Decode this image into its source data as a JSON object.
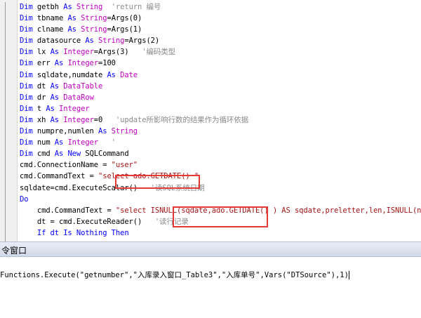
{
  "editor": {
    "lines": [
      [
        {
          "t": "Dim ",
          "c": "kw"
        },
        {
          "t": "getbh "
        },
        {
          "t": "As ",
          "c": "kw"
        },
        {
          "t": "String",
          "c": "mag"
        },
        {
          "t": "  'return 编号",
          "c": "cmt"
        }
      ],
      [
        {
          "t": "Dim ",
          "c": "kw"
        },
        {
          "t": "tbname "
        },
        {
          "t": "As ",
          "c": "kw"
        },
        {
          "t": "String",
          "c": "mag"
        },
        {
          "t": "=Args(0)"
        }
      ],
      [
        {
          "t": "Dim ",
          "c": "kw"
        },
        {
          "t": "clname "
        },
        {
          "t": "As ",
          "c": "kw"
        },
        {
          "t": "String",
          "c": "mag"
        },
        {
          "t": "=Args(1)"
        }
      ],
      [
        {
          "t": "Dim ",
          "c": "kw"
        },
        {
          "t": "datasource "
        },
        {
          "t": "As ",
          "c": "kw"
        },
        {
          "t": "String",
          "c": "mag"
        },
        {
          "t": "=Args(2)"
        }
      ],
      [
        {
          "t": "Dim ",
          "c": "kw"
        },
        {
          "t": "lx "
        },
        {
          "t": "As ",
          "c": "kw"
        },
        {
          "t": "Integer",
          "c": "mag"
        },
        {
          "t": "=Args(3)   "
        },
        {
          "t": "'编码类型",
          "c": "cmt"
        }
      ],
      [
        {
          "t": "Dim ",
          "c": "kw"
        },
        {
          "t": "err "
        },
        {
          "t": "As ",
          "c": "kw"
        },
        {
          "t": "Integer",
          "c": "mag"
        },
        {
          "t": "=100"
        }
      ],
      [
        {
          "t": "Dim ",
          "c": "kw"
        },
        {
          "t": "sqldate,numdate "
        },
        {
          "t": "As ",
          "c": "kw"
        },
        {
          "t": "Date",
          "c": "mag"
        }
      ],
      [
        {
          "t": "Dim ",
          "c": "kw"
        },
        {
          "t": "dt "
        },
        {
          "t": "As ",
          "c": "kw"
        },
        {
          "t": "DataTable",
          "c": "mag"
        }
      ],
      [
        {
          "t": "Dim ",
          "c": "kw"
        },
        {
          "t": "dr "
        },
        {
          "t": "As ",
          "c": "kw"
        },
        {
          "t": "DataRow",
          "c": "mag"
        }
      ],
      [
        {
          "t": "Dim ",
          "c": "kw"
        },
        {
          "t": "t "
        },
        {
          "t": "As ",
          "c": "kw"
        },
        {
          "t": "Integer",
          "c": "mag"
        }
      ],
      [
        {
          "t": "Dim ",
          "c": "kw"
        },
        {
          "t": "xh "
        },
        {
          "t": "As ",
          "c": "kw"
        },
        {
          "t": "Integer",
          "c": "mag"
        },
        {
          "t": "=0   "
        },
        {
          "t": "'update所影响行数的结果作为循环依据",
          "c": "cmt"
        }
      ],
      [
        {
          "t": "Dim ",
          "c": "kw"
        },
        {
          "t": "numpre,numlen "
        },
        {
          "t": "As ",
          "c": "kw"
        },
        {
          "t": "String",
          "c": "mag"
        }
      ],
      [
        {
          "t": "Dim ",
          "c": "kw"
        },
        {
          "t": "num "
        },
        {
          "t": "As ",
          "c": "kw"
        },
        {
          "t": "Integer",
          "c": "mag"
        },
        {
          "t": "   '",
          "c": "cmt"
        }
      ],
      [
        {
          "t": "Dim ",
          "c": "kw"
        },
        {
          "t": "cmd "
        },
        {
          "t": "As New ",
          "c": "kw"
        },
        {
          "t": "SQLCommand"
        }
      ],
      [
        {
          "t": "cmd.ConnectionName = "
        },
        {
          "t": "\"user\"",
          "c": "str"
        }
      ],
      [
        {
          "t": "cmd.CommandText = "
        },
        {
          "t": "\"select ado.GETDATE() \"",
          "c": "str"
        }
      ],
      [
        {
          "t": "sqldate=cmd.ExecuteScalar()   "
        },
        {
          "t": "'读SQL系统日期",
          "c": "cmt"
        }
      ],
      [
        {
          "t": "Do",
          "c": "kw"
        }
      ],
      [
        {
          "t": "    cmd.CommandText = "
        },
        {
          "t": "\"select ISNULL(sqdate,ado.GETDATE() ) AS sqdate,preletter,len,ISNULL(numbe",
          "c": "str"
        }
      ],
      [
        {
          "t": "    dt = cmd.ExecuteReader()   "
        },
        {
          "t": "'读行记录",
          "c": "cmt"
        }
      ],
      [
        {
          "t": "    If dt Is Nothing Then",
          "c": "kw"
        }
      ]
    ]
  },
  "panel": {
    "title": "令窗口",
    "command": "Functions.Execute(\"getnumber\",\"入库录入窗口_Table3\",\"入库单号\",Vars(\"DTSource\"),1)"
  }
}
